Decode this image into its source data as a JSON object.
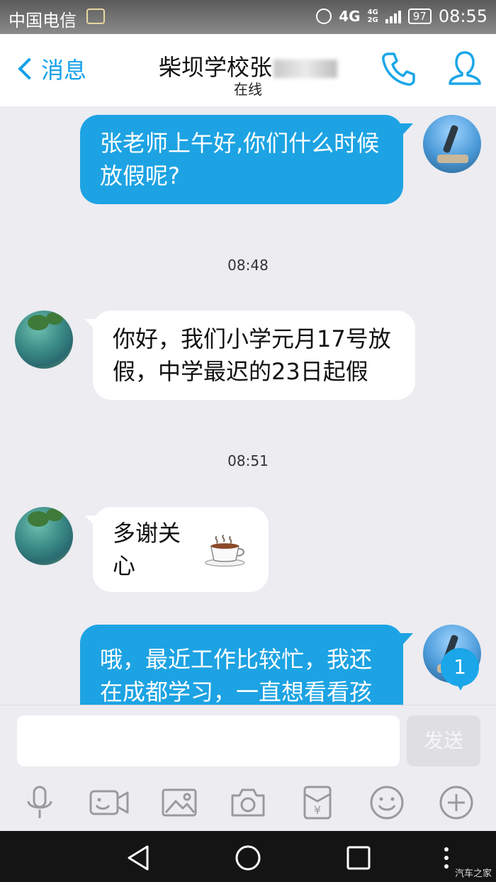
{
  "status_bar": {
    "carrier": "中国电信",
    "network": "4G",
    "sub_network_top": "4G",
    "sub_network_bottom": "2G",
    "battery": "97",
    "time": "08:55"
  },
  "header": {
    "back_label": "消息",
    "contact_name": "柴坝学校张",
    "contact_status": "在线",
    "phone_icon": "phone-icon",
    "profile_icon": "profile-icon"
  },
  "messages": [
    {
      "direction": "out",
      "text_line1": "张老师上午好,你们什么时候",
      "text_line2": "放假呢?"
    },
    {
      "timestamp": "08:48"
    },
    {
      "direction": "in",
      "text_line1": "你好，我们小学元月17号放",
      "text_line2": "假，中学最迟的23日起假"
    },
    {
      "timestamp": "08:51"
    },
    {
      "direction": "in",
      "text": "多谢关心",
      "emoji": "coffee-cup-icon"
    },
    {
      "direction": "out",
      "text_line1": "哦，最近工作比较忙，我还",
      "text_line2": "在成都学习，一直想看看孩"
    }
  ],
  "unread_count": "1",
  "input": {
    "placeholder": "",
    "send_label": "发送"
  },
  "toolbar": [
    "microphone-icon",
    "video-call-icon",
    "image-icon",
    "camera-icon",
    "red-packet-icon",
    "emoji-icon",
    "plus-icon"
  ],
  "watermark": "汽车之家",
  "colors": {
    "accent": "#1da3e3",
    "background": "#ececf1"
  }
}
